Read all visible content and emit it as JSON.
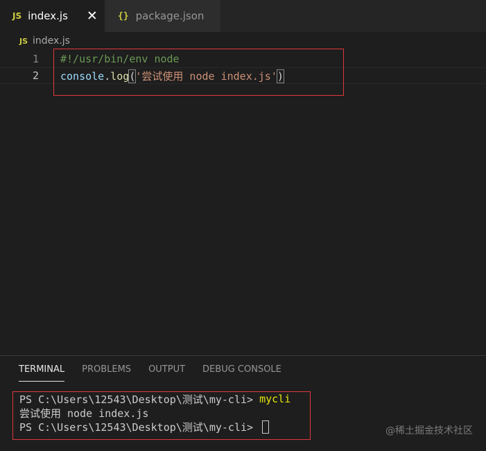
{
  "tabs": [
    {
      "icon": "JS",
      "label": "index.js",
      "close": "✕"
    },
    {
      "icon": "{}",
      "label": "package.json"
    }
  ],
  "breadcrumb": {
    "icon": "JS",
    "file": "index.js"
  },
  "editor": {
    "lines": [
      {
        "number": "1",
        "text": "#!/usr/bin/env node"
      },
      {
        "number": "2",
        "object": "console",
        "dot": ".",
        "fn": "log",
        "open": "(",
        "string": "'尝试使用 node index.js'",
        "close": ")"
      }
    ]
  },
  "panel": {
    "tabs": [
      "TERMINAL",
      "PROBLEMS",
      "OUTPUT",
      "DEBUG CONSOLE"
    ],
    "active_tab": "TERMINAL"
  },
  "terminal": {
    "lines": [
      {
        "prompt": "PS C:\\Users\\12543\\Desktop\\测试\\my-cli> ",
        "command": "mycli"
      },
      {
        "output": "尝试使用 node index.js"
      },
      {
        "prompt": "PS C:\\Users\\12543\\Desktop\\测试\\my-cli> "
      }
    ]
  },
  "watermark": "@稀土掘金技术社区",
  "colors": {
    "highlight_box": "#e0383e",
    "editor_bg": "#1e1e1e",
    "tab_inactive_bg": "#2d2d2d"
  }
}
